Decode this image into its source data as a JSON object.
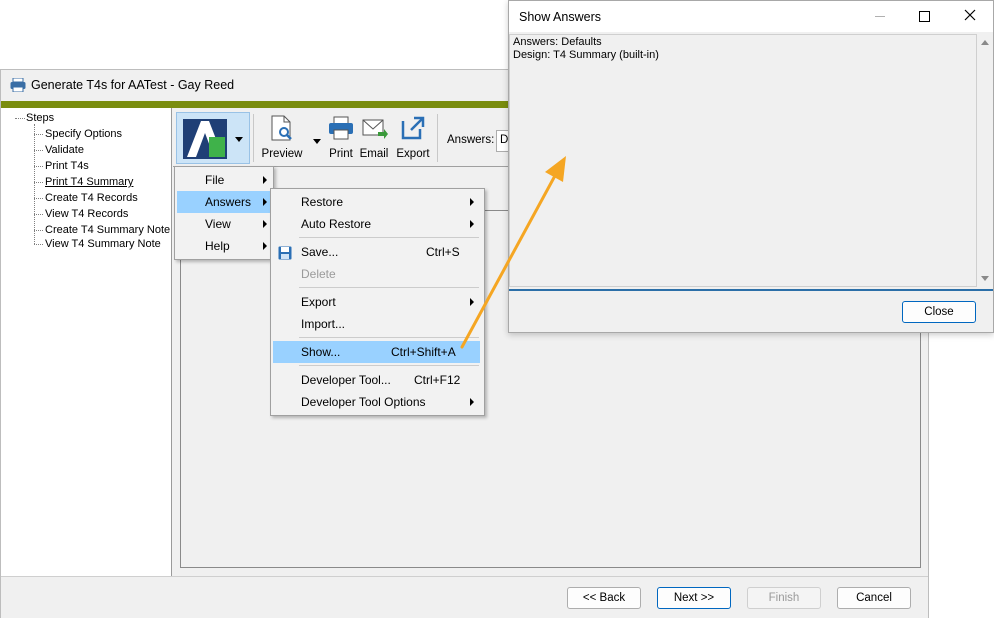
{
  "main_window": {
    "title": "Generate T4s for AATest - Gay Reed",
    "steps": {
      "root": "Steps",
      "items": [
        "Specify Options",
        "Validate",
        "Print T4s",
        "Print T4 Summary",
        "Create T4 Records",
        "View T4 Records",
        "Create T4 Summary Note",
        "View T4 Summary Note"
      ],
      "current_index": 3
    },
    "toolbar": {
      "preview": "Preview",
      "print": "Print",
      "email": "Email",
      "export": "Export",
      "answers_label": "Answers:",
      "answers_value": "D"
    },
    "footer": {
      "back": "<< Back",
      "next": "Next >>",
      "finish": "Finish",
      "cancel": "Cancel"
    }
  },
  "app_menu": {
    "items": [
      "File",
      "Answers",
      "View",
      "Help"
    ],
    "highlighted": "Answers"
  },
  "answers_menu": {
    "restore": "Restore",
    "auto_restore": "Auto Restore",
    "save": "Save...",
    "save_shortcut": "Ctrl+S",
    "delete": "Delete",
    "export": "Export",
    "import": "Import...",
    "show": "Show...",
    "show_shortcut": "Ctrl+Shift+A",
    "developer_tool": "Developer Tool...",
    "developer_tool_shortcut": "Ctrl+F12",
    "developer_tool_options": "Developer Tool Options"
  },
  "show_answers_window": {
    "title": "Show Answers",
    "line1": "Answers: Defaults",
    "line2": "Design: T4 Summary (built-in)",
    "close_button": "Close"
  },
  "colors": {
    "olive_bar": "#7a8d0f",
    "menu_highlight": "#99d1ff",
    "annotation_arrow": "#f5a623",
    "separator_blue": "#2b6fa8"
  }
}
